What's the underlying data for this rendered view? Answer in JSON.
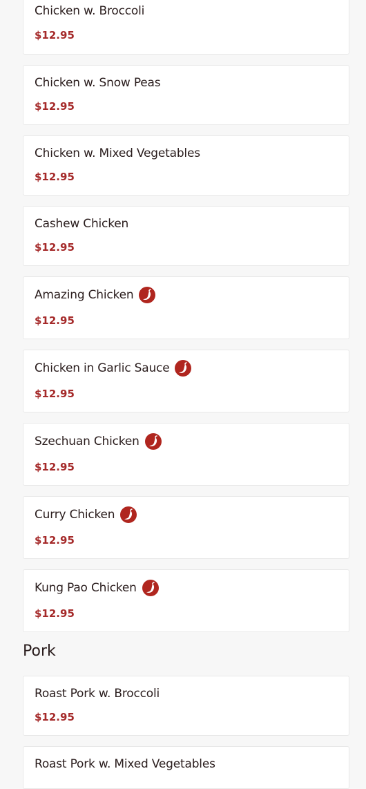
{
  "colors": {
    "price": "#a52a2a",
    "title": "#2a1d1d",
    "spicy": "#b0261f",
    "background": "#f7f7f7"
  },
  "chicken_items": [
    {
      "name": "Chicken w. Broccoli",
      "price": "$12.95",
      "spicy": false
    },
    {
      "name": "Chicken w. Snow Peas",
      "price": "$12.95",
      "spicy": false
    },
    {
      "name": "Chicken w. Mixed Vegetables",
      "price": "$12.95",
      "spicy": false
    },
    {
      "name": "Cashew Chicken",
      "price": "$12.95",
      "spicy": false
    },
    {
      "name": "Amazing Chicken",
      "price": "$12.95",
      "spicy": true
    },
    {
      "name": "Chicken in Garlic Sauce",
      "price": "$12.95",
      "spicy": true
    },
    {
      "name": "Szechuan Chicken",
      "price": "$12.95",
      "spicy": true
    },
    {
      "name": "Curry Chicken",
      "price": "$12.95",
      "spicy": true
    },
    {
      "name": "Kung Pao Chicken",
      "price": "$12.95",
      "spicy": true
    }
  ],
  "pork_section": {
    "title": "Pork",
    "items": [
      {
        "name": "Roast Pork w. Broccoli",
        "price": "$12.95",
        "spicy": false
      },
      {
        "name": "Roast Pork w. Mixed Vegetables",
        "price": "",
        "spicy": false
      }
    ]
  },
  "icons": {
    "spicy": "chili-pepper-icon"
  }
}
